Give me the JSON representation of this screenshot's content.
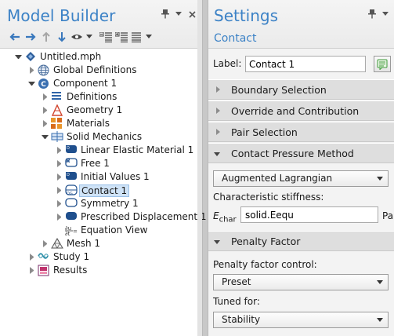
{
  "model_builder": {
    "title": "Model Builder",
    "tree": [
      {
        "label": "Untitled.mph",
        "icon": "model-file-icon",
        "level": 0,
        "twisty": "open",
        "name": "tree-item-untitled"
      },
      {
        "label": "Global Definitions",
        "icon": "globe-icon",
        "level": 1,
        "twisty": "closed",
        "name": "tree-item-global-definitions"
      },
      {
        "label": "Component 1",
        "icon": "component-icon",
        "level": 1,
        "twisty": "open",
        "name": "tree-item-component-1"
      },
      {
        "label": "Definitions",
        "icon": "definitions-icon",
        "level": 2,
        "twisty": "closed",
        "name": "tree-item-definitions"
      },
      {
        "label": "Geometry 1",
        "icon": "geometry-icon",
        "level": 2,
        "twisty": "closed",
        "name": "tree-item-geometry-1"
      },
      {
        "label": "Materials",
        "icon": "materials-icon",
        "level": 2,
        "twisty": "closed",
        "name": "tree-item-materials"
      },
      {
        "label": "Solid Mechanics",
        "icon": "solid-mechanics-icon",
        "level": 2,
        "twisty": "open",
        "name": "tree-item-solid-mechanics"
      },
      {
        "label": "Linear Elastic Material 1",
        "icon": "domain-feature-icon",
        "level": 3,
        "twisty": "closed",
        "name": "tree-item-linear-elastic-material-1"
      },
      {
        "label": "Free 1",
        "icon": "boundary-feature-icon",
        "level": 3,
        "twisty": "closed",
        "name": "tree-item-free-1"
      },
      {
        "label": "Initial Values 1",
        "icon": "domain-feature-icon",
        "level": 3,
        "twisty": "closed",
        "name": "tree-item-initial-values-1"
      },
      {
        "label": "Contact 1",
        "icon": "pair-feature-icon",
        "level": 3,
        "twisty": "closed",
        "selected": true,
        "name": "tree-item-contact-1"
      },
      {
        "label": "Symmetry 1",
        "icon": "boundary-outline-icon",
        "level": 3,
        "twisty": "closed",
        "name": "tree-item-symmetry-1"
      },
      {
        "label": "Prescribed Displacement 1",
        "icon": "boundary-filled-icon",
        "level": 3,
        "twisty": "closed",
        "name": "tree-item-prescribed-displacement-1"
      },
      {
        "label": "Equation View",
        "icon": "equation-view-icon",
        "level": 3,
        "twisty": "none",
        "name": "tree-item-equation-view"
      },
      {
        "label": "Mesh 1",
        "icon": "mesh-icon",
        "level": 2,
        "twisty": "closed",
        "name": "tree-item-mesh-1"
      },
      {
        "label": "Study 1",
        "icon": "study-icon",
        "level": 1,
        "twisty": "closed",
        "name": "tree-item-study-1"
      },
      {
        "label": "Results",
        "icon": "results-icon",
        "level": 1,
        "twisty": "closed",
        "name": "tree-item-results"
      }
    ]
  },
  "settings": {
    "title": "Settings",
    "subtitle": "Contact",
    "label_field_label": "Label:",
    "label_value": "Contact 1",
    "sections": {
      "boundary_selection": "Boundary Selection",
      "override": "Override and Contribution",
      "pair_selection": "Pair Selection",
      "contact_pressure": "Contact Pressure Method",
      "penalty_factor": "Penalty Factor"
    },
    "contact_method_value": "Augmented Lagrangian",
    "char_stiffness_label": "Characteristic stiffness:",
    "echar_symbol": "E",
    "echar_sub": "char",
    "echar_value": "solid.Eequ",
    "echar_unit": "Pa",
    "penalty_control_label": "Penalty factor control:",
    "penalty_control_value": "Preset",
    "tuned_for_label": "Tuned for:",
    "tuned_for_value": "Stability"
  },
  "colors": {
    "title_blue": "#3c82c6",
    "selection": "#cfe3f7"
  }
}
